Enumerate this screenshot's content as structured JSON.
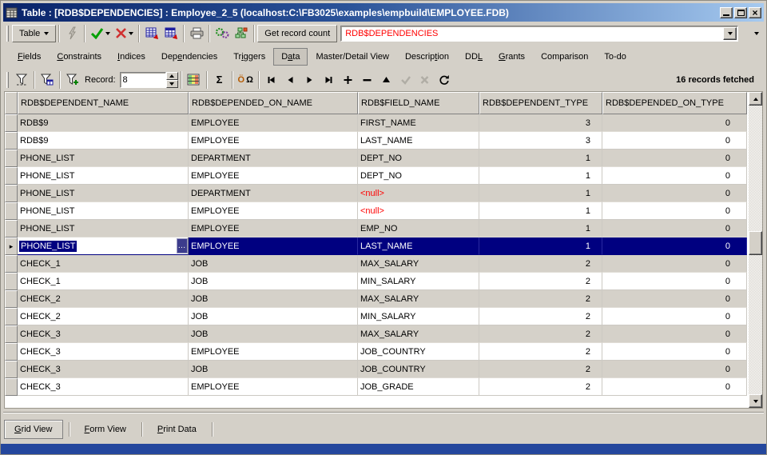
{
  "window": {
    "title": "Table : [RDB$DEPENDENCIES] : Employee_2_5 (localhost:C:\\FB3025\\examples\\empbuild\\EMPLOYEE.FDB)"
  },
  "toolbar": {
    "table_button": "Table",
    "get_record_count": "Get record count",
    "object_combo": "RDB$DEPENDENCIES"
  },
  "tabs": {
    "selected": "Data",
    "items": [
      {
        "label": "Fields",
        "u": 0
      },
      {
        "label": "Constraints",
        "u": 0
      },
      {
        "label": "Indices",
        "u": 0
      },
      {
        "label": "Dependencies",
        "u": 3
      },
      {
        "label": "Triggers",
        "u": 2
      },
      {
        "label": "Data",
        "u": 1
      },
      {
        "label": "Master/Detail View",
        "u": -1
      },
      {
        "label": "Description",
        "u": 7
      },
      {
        "label": "DDL",
        "u": 2
      },
      {
        "label": "Grants",
        "u": 0
      },
      {
        "label": "Comparison",
        "u": -1
      },
      {
        "label": "To-do",
        "u": -1
      }
    ]
  },
  "data_toolbar": {
    "record_label": "Record:",
    "record_value": "8",
    "status": "16 records fetched"
  },
  "grid": {
    "columns": [
      "RDB$DEPENDENT_NAME",
      "RDB$DEPENDED_ON_NAME",
      "RDB$FIELD_NAME",
      "RDB$DEPENDENT_TYPE",
      "RDB$DEPENDED_ON_TYPE"
    ],
    "rows": [
      [
        "RDB$9",
        "EMPLOYEE",
        "FIRST_NAME",
        "3",
        "0"
      ],
      [
        "RDB$9",
        "EMPLOYEE",
        "LAST_NAME",
        "3",
        "0"
      ],
      [
        "PHONE_LIST",
        "DEPARTMENT",
        "DEPT_NO",
        "1",
        "0"
      ],
      [
        "PHONE_LIST",
        "EMPLOYEE",
        "DEPT_NO",
        "1",
        "0"
      ],
      [
        "PHONE_LIST",
        "DEPARTMENT",
        "<null>",
        "1",
        "0"
      ],
      [
        "PHONE_LIST",
        "EMPLOYEE",
        "<null>",
        "1",
        "0"
      ],
      [
        "PHONE_LIST",
        "EMPLOYEE",
        "EMP_NO",
        "1",
        "0"
      ],
      [
        "PHONE_LIST",
        "EMPLOYEE",
        "LAST_NAME",
        "1",
        "0"
      ],
      [
        "CHECK_1",
        "JOB",
        "MAX_SALARY",
        "2",
        "0"
      ],
      [
        "CHECK_1",
        "JOB",
        "MIN_SALARY",
        "2",
        "0"
      ],
      [
        "CHECK_2",
        "JOB",
        "MAX_SALARY",
        "2",
        "0"
      ],
      [
        "CHECK_2",
        "JOB",
        "MIN_SALARY",
        "2",
        "0"
      ],
      [
        "CHECK_3",
        "JOB",
        "MAX_SALARY",
        "2",
        "0"
      ],
      [
        "CHECK_3",
        "EMPLOYEE",
        "JOB_COUNTRY",
        "2",
        "0"
      ],
      [
        "CHECK_3",
        "JOB",
        "JOB_COUNTRY",
        "2",
        "0"
      ],
      [
        "CHECK_3",
        "EMPLOYEE",
        "JOB_GRADE",
        "2",
        "0"
      ]
    ],
    "selected_row_index": 7,
    "editing_cell": {
      "row": 7,
      "col": 0,
      "value": "PHONE_LIST"
    }
  },
  "bottom_tabs": {
    "selected": "Grid View",
    "items": [
      {
        "label": "Grid View",
        "u": 0
      },
      {
        "label": "Form View",
        "u": 0
      },
      {
        "label": "Print Data",
        "u": 0
      }
    ]
  },
  "icons": {
    "sigma_glyph": "Σ",
    "blob_o": "Ö",
    "blob_omega": "Ω",
    "row_pointer_glyph": "▸",
    "ellipsis_glyph": "…",
    "names": [
      "table-window-icon",
      "minimize-icon",
      "maximize-icon",
      "close-icon",
      "lightning-icon",
      "commit-check-icon",
      "rollback-cross-icon",
      "data-grid-icon",
      "data-grid-alt-icon",
      "print-icon",
      "gears-icon",
      "structure-icon",
      "combo-dropdown-icon",
      "toolbar-overflow-chevron",
      "filter-icon",
      "filter-form-icon",
      "filter-add-icon",
      "cube-grid-icon",
      "sigma-icon",
      "blob-view-icon",
      "nav-first-icon",
      "nav-prior-icon",
      "nav-next-icon",
      "nav-last-icon",
      "nav-insert-icon",
      "nav-delete-icon",
      "nav-edit-icon",
      "nav-post-icon",
      "nav-cancel-icon",
      "nav-refresh-icon",
      "row-pointer-icon",
      "ellipsis-button"
    ]
  },
  "colors": {
    "selection": "#000080",
    "null_text": "#ff0000",
    "combo_text": "#ff0000",
    "titlebar_start": "#0a246a",
    "titlebar_end": "#a6caf0",
    "bottom_bar": "#24479d",
    "chrome": "#d4d0c8"
  }
}
